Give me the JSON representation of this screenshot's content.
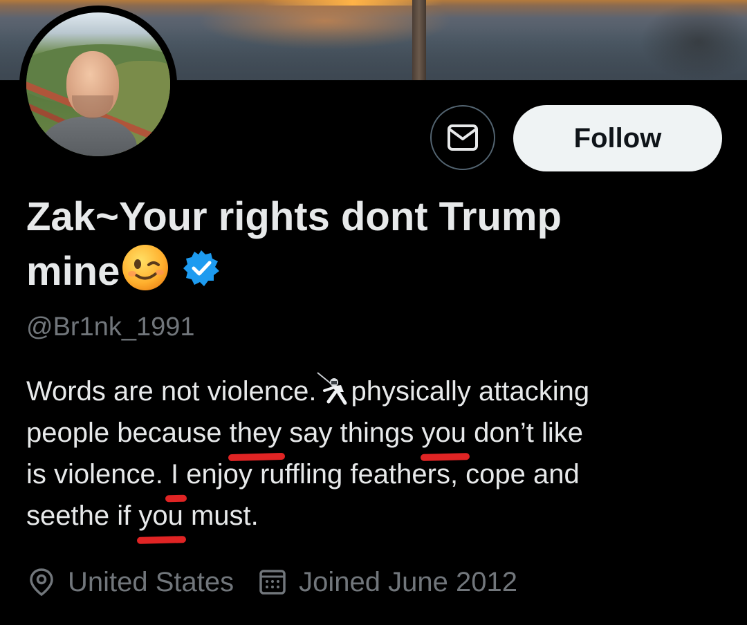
{
  "profile": {
    "display_name_line1": "Zak~Your rights dont Trump",
    "display_name_line2": "mine",
    "name_emoji": "winking-face-emoji",
    "verified": true,
    "verified_color": "#1d9bf0",
    "handle": "@Br1nk_1991"
  },
  "actions": {
    "message_icon": "envelope-icon",
    "follow_label": "Follow"
  },
  "bio": {
    "line1_before": "Words are not violence.",
    "line1_emoji": "fencer-emoji",
    "line1_after": "physically attacking",
    "line2_a": "people because ",
    "line2_they": "they",
    "line2_b": " say things ",
    "line2_you": "you",
    "line2_c": " don’t like",
    "line3_a": "is violence. ",
    "line3_i": "I",
    "line3_b": " enjoy ruffling feathers, cope and",
    "line4_a": "seethe if ",
    "line4_you": "you",
    "line4_b": " must.",
    "highlight_color": "#e02424"
  },
  "meta": {
    "location_icon": "location-pin-icon",
    "location": "United States",
    "joined_icon": "calendar-icon",
    "joined": "Joined June 2012"
  }
}
